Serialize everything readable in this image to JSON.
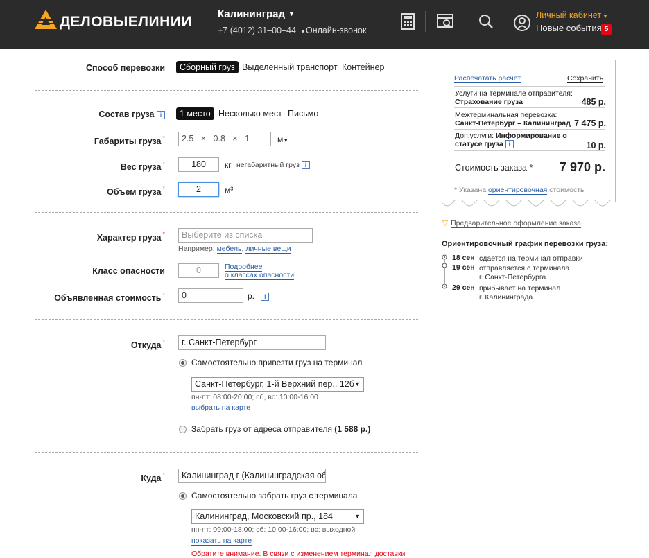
{
  "header": {
    "logo_text": "ДЕЛОВЫЕЛИНИИ",
    "city": "Калининград",
    "phone": "+7 (4012) 31–00–44",
    "online_call": "Онлайн-звонок",
    "cabinet": "Личный кабинет",
    "events": "Новые события",
    "events_count": "5",
    "icons": [
      "calculator-icon",
      "tracking-icon",
      "search-icon",
      "user-icon"
    ]
  },
  "form": {
    "transport": {
      "label": "Способ перевозки",
      "options": [
        "Сборный груз",
        "Выделенный транспорт",
        "Контейнер"
      ],
      "selected": "Сборный груз"
    },
    "composition": {
      "label": "Состав груза",
      "options": [
        "1 место",
        "Несколько мест",
        "Письмо"
      ],
      "selected": "1 место"
    },
    "dimensions": {
      "label": "Габариты груза",
      "value": "2.5   ×   0.8   ×   1",
      "unit": "м"
    },
    "weight": {
      "label": "Вес груза",
      "value": "180",
      "unit": "кг",
      "oversize": "негабаритный груз"
    },
    "volume": {
      "label": "Объем груза",
      "value": "2",
      "unit": "м³"
    },
    "nature": {
      "label": "Характер груза",
      "placeholder": "Выберите из списка",
      "example_prefix": "Например:",
      "examples": [
        "мебель",
        "личные вещи"
      ]
    },
    "danger": {
      "label": "Класс опасности",
      "value": "0",
      "link_line1": "Подробнее",
      "link_line2": "о классах опасности"
    },
    "declared": {
      "label": "Объявленная стоимость",
      "value": "0",
      "unit": "р."
    },
    "from": {
      "label": "Откуда",
      "value": "г. Санкт-Петербург",
      "option1": "Самостоятельно привезти груз на терминал",
      "terminal": "Санкт-Петербург, 1-й Верхний пер., 12б",
      "hours": "пн-пт: 08:00-20:00; сб, вс: 10:00-16:00",
      "map_link": "выбрать на карте",
      "option2": "Забрать груз от адреса отправителя",
      "option2_price": "(1 588 р.)"
    },
    "to": {
      "label": "Куда",
      "value": "Калининград г (Калининградская обл",
      "option1": "Самостоятельно забрать груз с терминала",
      "terminal": "Калининград, Московский пр., 184",
      "hours": "пн-пт: 09:00-18:00; сб: 10:00-16:00; вс: выходной",
      "map_link": "показать на карте",
      "notice": "Обратите внимание. В связи с изменением терминал доставки"
    }
  },
  "sidebar": {
    "print": "Распечатать расчет",
    "save": "Сохранить",
    "rows": [
      {
        "head": "Услуги на терминале отправителя:",
        "name": "Страхование груза",
        "value": "485 р."
      },
      {
        "head": "Межтерминальная перевозка:",
        "name": "Санкт-Петербург – Калининград",
        "value": "7 475 р."
      },
      {
        "head": "Доп.услуги:",
        "name_line1": "Информирование о",
        "name_line2": "статусе груза",
        "value": "10 р."
      }
    ],
    "total_label": "Стоимость заказа *",
    "total_value": "7 970 р.",
    "note_prefix": "* Указана",
    "note_link": "ориентировочная",
    "note_suffix": "стоимость",
    "preorder": "Предварительное оформление заказа",
    "schedule_title": "Ориентировочный график перевозки груза:",
    "schedule": [
      {
        "date": "18 сен",
        "text": "сдается на терминал отправки"
      },
      {
        "date": "19 сен",
        "text": "отправляется с терминала",
        "sub": "г. Санкт-Петербурга"
      },
      {
        "date": "29 сен",
        "text": "прибывает на терминал",
        "sub": "г. Калининграда"
      }
    ]
  }
}
